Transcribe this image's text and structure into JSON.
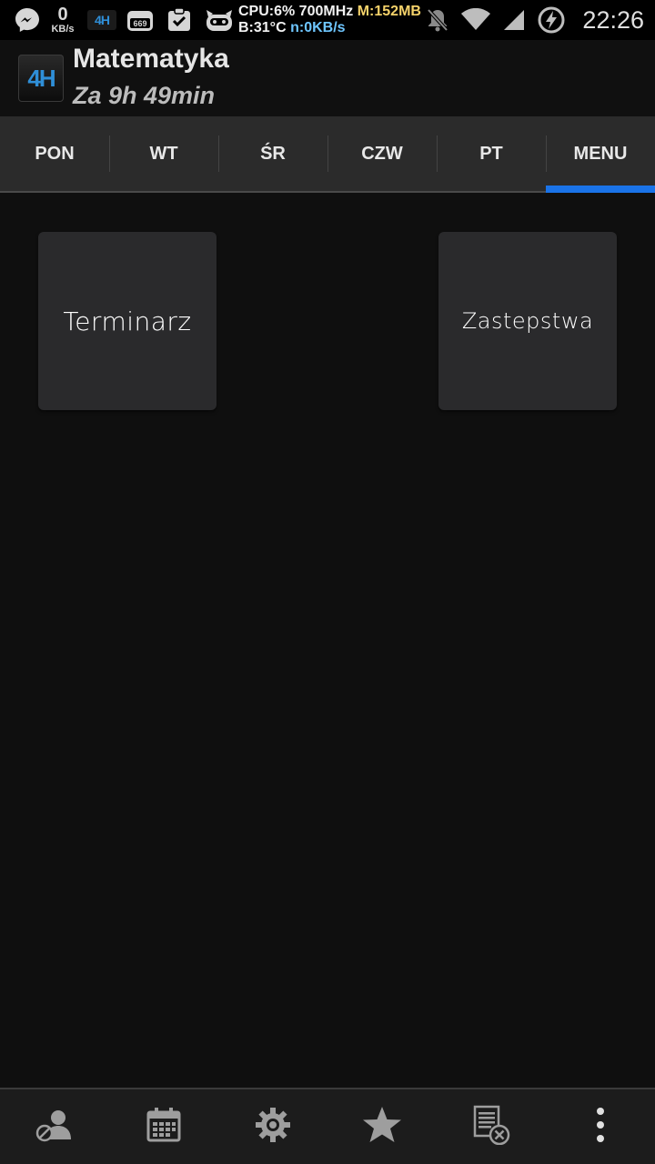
{
  "status_bar": {
    "net_speed_value": "0",
    "net_speed_unit": "KB/s",
    "app_badge": "4H",
    "counter_badge": "669",
    "cpu_text": "CPU:6% 700MHz",
    "mem_text": "M:152MB",
    "battery_temp_text": "B:31°C",
    "network_rate_text": "n:0KB/s",
    "clock": "22:26",
    "icons": [
      "messenger-icon",
      "4h-app-icon",
      "counter-icon",
      "clipboard-check-icon",
      "cyanogen-icon",
      "notifications-off-icon",
      "wifi-icon",
      "signal-icon",
      "battery-charging-icon"
    ]
  },
  "header": {
    "logo_text": "4H",
    "title": "Matematyka",
    "subtitle": "Za 9h 49min"
  },
  "tabs": [
    {
      "label": "PON",
      "active": false
    },
    {
      "label": "WT",
      "active": false
    },
    {
      "label": "ŚR",
      "active": false
    },
    {
      "label": "CZW",
      "active": false
    },
    {
      "label": "PT",
      "active": false
    },
    {
      "label": "MENU",
      "active": true
    }
  ],
  "menu_tiles": [
    {
      "label": "Terminarz"
    },
    {
      "label": "Zastepstwa"
    }
  ],
  "bottom_bar": {
    "icons": [
      "contact-block-icon",
      "calendar-icon",
      "settings-gear-icon",
      "star-icon",
      "list-remove-icon",
      "overflow-menu-icon"
    ]
  },
  "colors": {
    "accent": "#1a73e8",
    "background": "#0f0f0f",
    "tab_bar": "#2b2b2b",
    "tile": "#2a2a2c",
    "cpu_text": "#f2f2f2",
    "mem_text": "#f5d26a",
    "net_text": "#6ec6ff"
  }
}
